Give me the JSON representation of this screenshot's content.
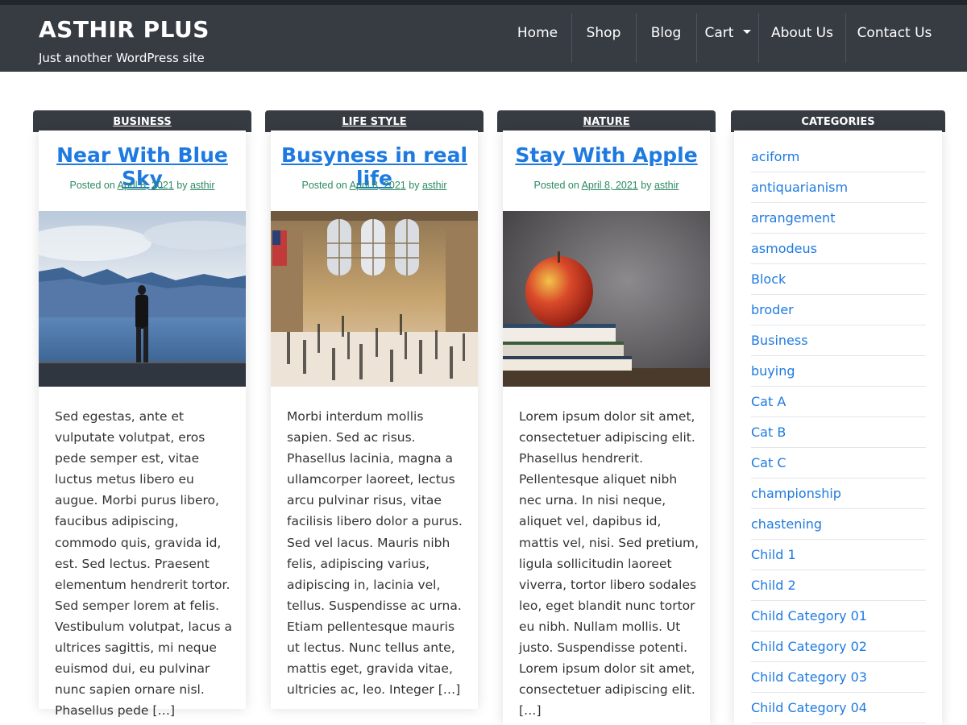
{
  "site": {
    "title": "ASTHIR PLUS",
    "tagline": "Just another WordPress site"
  },
  "nav": {
    "items": [
      {
        "label": "Home"
      },
      {
        "label": "Shop"
      },
      {
        "label": "Blog"
      },
      {
        "label": "Cart"
      },
      {
        "label": "About Us"
      },
      {
        "label": "Contact Us"
      }
    ]
  },
  "posts": [
    {
      "category": "BUSINESS",
      "title": "Near With Blue Sky",
      "posted_on": "Posted on",
      "date": "April 8, 2021",
      "by": "by",
      "author": "asthir",
      "image": "man-by-lake-photo",
      "excerpt": "Sed egestas, ante et vulputate volutpat, eros pede semper est, vitae luctus metus libero eu augue. Morbi purus libero, faucibus adipiscing, commodo quis, gravida id, est. Sed lectus. Praesent elementum hendrerit tortor. Sed semper lorem at felis. Vestibulum volutpat, lacus a ultrices sagittis, mi neque euismod dui, eu pulvinar nunc sapien ornare nisl. Phasellus pede […]"
    },
    {
      "category": "LIFE STYLE",
      "title": "Busyness in real life",
      "posted_on": "Posted on",
      "date": "April 8, 2021",
      "by": "by",
      "author": "asthir",
      "image": "grand-central-crowd-photo",
      "excerpt": "Morbi interdum mollis sapien. Sed ac risus. Phasellus lacinia, magna a ullamcorper laoreet, lectus arcu pulvinar risus, vitae facilisis libero dolor a purus. Sed vel lacus. Mauris nibh felis, adipiscing varius, adipiscing in, lacinia vel, tellus. Suspendisse ac urna. Etiam pellentesque mauris ut lectus. Nunc tellus ante, mattis eget, gravida vitae, ultricies ac, leo. Integer […]"
    },
    {
      "category": "NATURE",
      "title": "Stay With Apple",
      "posted_on": "Posted on",
      "date": "April 8, 2021",
      "by": "by",
      "author": "asthir",
      "image": "apple-on-books-photo",
      "excerpt": "Lorem ipsum dolor sit amet, consectetuer adipiscing elit. Phasellus hendrerit. Pellentesque aliquet nibh nec urna. In nisi neque, aliquet vel, dapibus id, mattis vel, nisi. Sed pretium, ligula sollicitudin laoreet viverra, tortor libero sodales leo, eget blandit nunc tortor eu nibh. Nullam mollis. Ut justo. Suspendisse potenti. Lorem ipsum dolor sit amet, consectetuer adipiscing elit. […]"
    }
  ],
  "sidebar": {
    "heading": "CATEGORIES",
    "categories": [
      "aciform",
      "antiquarianism",
      "arrangement",
      "asmodeus",
      "Block",
      "broder",
      "Business",
      "buying",
      "Cat A",
      "Cat B",
      "Cat C",
      "championship",
      "chastening",
      "Child 1",
      "Child 2",
      "Child Category 01",
      "Child Category 02",
      "Child Category 03",
      "Child Category 04"
    ]
  },
  "colors": {
    "header_bg": "#373b42",
    "link_blue": "#1e7ae0",
    "meta_green": "#2b8a63",
    "text": "#333333"
  }
}
